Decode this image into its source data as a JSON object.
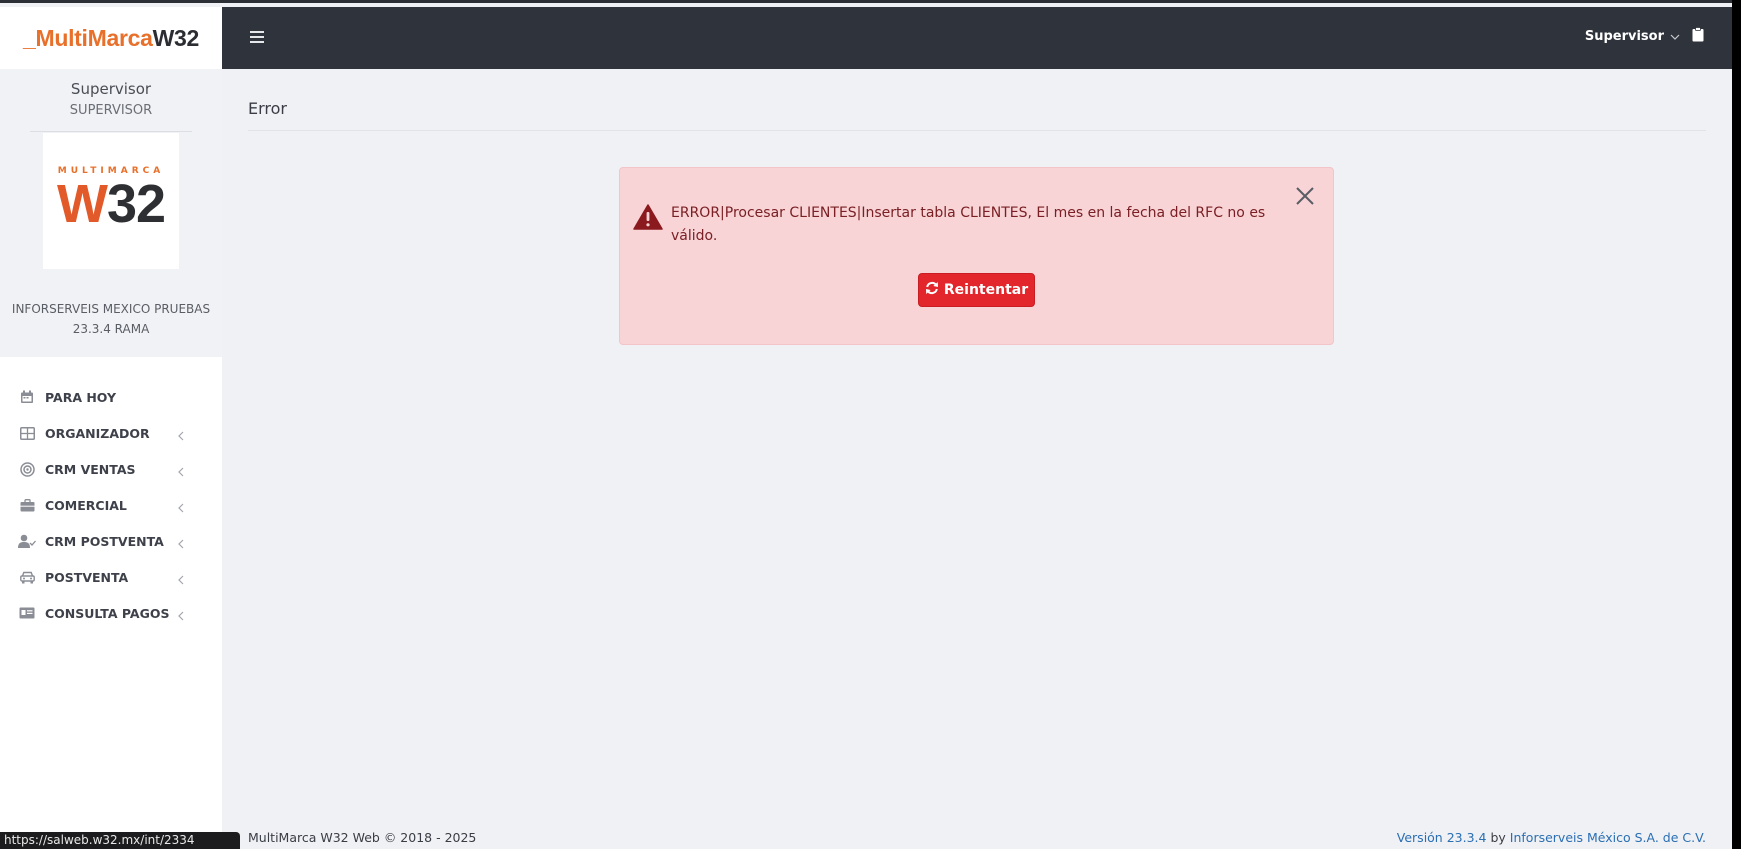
{
  "brand": {
    "prefix": "_MultiMarca",
    "suffix": "W32"
  },
  "user_panel": {
    "name": "Supervisor",
    "role": "SUPERVISOR",
    "logo_small": "MULTIMARCA",
    "logo_w": "W",
    "logo_num": "32",
    "company": "INFORSERVEIS MEXICO PRUEBAS",
    "version_branch": "23.3.4 RAMA"
  },
  "menu": [
    {
      "label": "PARA HOY",
      "icon": "calendar-icon",
      "has_submenu": false
    },
    {
      "label": "ORGANIZADOR",
      "icon": "grid-icon",
      "has_submenu": true
    },
    {
      "label": "CRM VENTAS",
      "icon": "target-icon",
      "has_submenu": true
    },
    {
      "label": "COMERCIAL",
      "icon": "briefcase-icon",
      "has_submenu": true
    },
    {
      "label": "CRM POSTVENTA",
      "icon": "user-check-icon",
      "has_submenu": true
    },
    {
      "label": "POSTVENTA",
      "icon": "car-icon",
      "has_submenu": true
    },
    {
      "label": "CONSULTA PAGOS",
      "icon": "id-card-icon",
      "has_submenu": true
    }
  ],
  "topbar": {
    "user_label": "Supervisor"
  },
  "page": {
    "title": "Error"
  },
  "alert": {
    "message": "ERROR|Procesar CLIENTES|Insertar tabla CLIENTES, El mes en la fecha del RFC no es válido.",
    "retry_label": "Reintentar"
  },
  "footer": {
    "copyright": "MultiMarca W32 Web © 2018 - 2025",
    "version_link": "Versión 23.3.4",
    "by": "by",
    "company_link": "Inforserveis México S.A. de C.V."
  },
  "status_url": "https://salweb.w32.mx/int/2334",
  "colors": {
    "brand_orange": "#e8702a",
    "topbar": "#2f333b",
    "alert_bg": "#f8d4d6",
    "alert_text": "#7a2025",
    "danger": "#e2262b",
    "link": "#2a6fb3"
  }
}
